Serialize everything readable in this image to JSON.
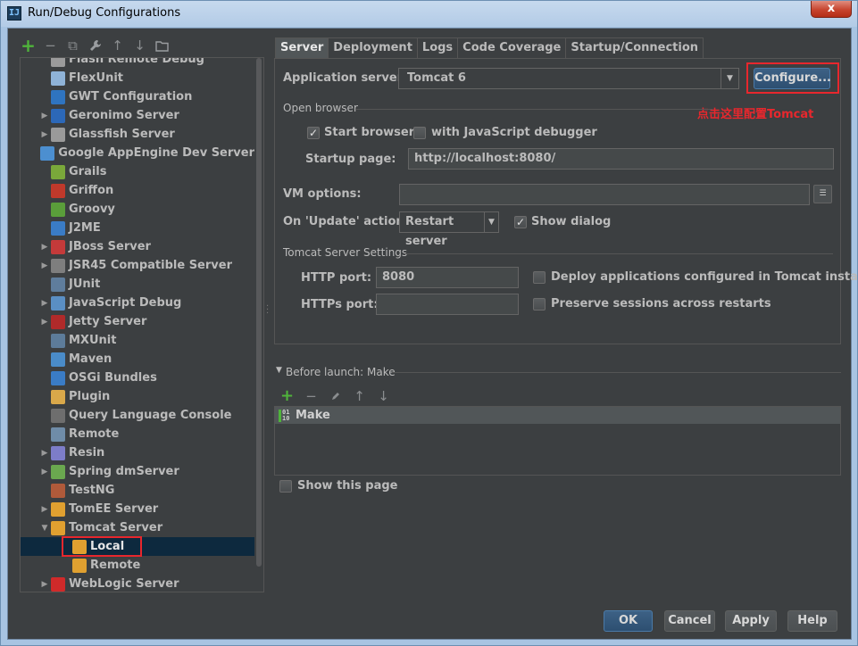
{
  "window": {
    "title": "Run/Debug Configurations",
    "app_icon": "IJ",
    "close": "x"
  },
  "left_toolbar": {
    "add": "+",
    "remove": "−",
    "copy": "⧉",
    "edit_defaults": "🔧",
    "move_up": "↑",
    "move_down": "↓",
    "folder": "▭"
  },
  "tree": [
    {
      "label": "Flash Remote Debug",
      "icon": "flash-remote-icon",
      "color": "#9b9b9b",
      "expandable": false
    },
    {
      "label": "FlexUnit",
      "icon": "flexunit-icon",
      "color": "#8fb3d8",
      "expandable": false
    },
    {
      "label": "GWT Configuration",
      "icon": "gwt-icon",
      "color": "#2f74c0",
      "expandable": false
    },
    {
      "label": "Geronimo Server",
      "icon": "geronimo-icon",
      "color": "#2c68b8",
      "expandable": true
    },
    {
      "label": "Glassfish Server",
      "icon": "glassfish-icon",
      "color": "#9a9a9a",
      "expandable": true
    },
    {
      "label": "Google AppEngine Dev Server",
      "icon": "appengine-icon",
      "color": "#4c8fd0",
      "expandable": false
    },
    {
      "label": "Grails",
      "icon": "grails-icon",
      "color": "#7aa83a",
      "expandable": false
    },
    {
      "label": "Griffon",
      "icon": "griffon-icon",
      "color": "#c0392b",
      "expandable": false
    },
    {
      "label": "Groovy",
      "icon": "groovy-icon",
      "color": "#5a9e3a",
      "expandable": false
    },
    {
      "label": "J2ME",
      "icon": "j2me-icon",
      "color": "#3a7cc6",
      "expandable": false
    },
    {
      "label": "JBoss Server",
      "icon": "jboss-icon",
      "color": "#c43a3a",
      "expandable": true
    },
    {
      "label": "JSR45 Compatible Server",
      "icon": "jsr45-icon",
      "color": "#7e7e7e",
      "expandable": true
    },
    {
      "label": "JUnit",
      "icon": "junit-icon",
      "color": "#5f7d9c",
      "expandable": false
    },
    {
      "label": "JavaScript Debug",
      "icon": "js-debug-icon",
      "color": "#5a8fc4",
      "expandable": true
    },
    {
      "label": "Jetty Server",
      "icon": "jetty-icon",
      "color": "#b02a2a",
      "expandable": true
    },
    {
      "label": "MXUnit",
      "icon": "mxunit-icon",
      "color": "#5d7c9a",
      "expandable": false
    },
    {
      "label": "Maven",
      "icon": "maven-icon",
      "color": "#4a8cc9",
      "expandable": false
    },
    {
      "label": "OSGi Bundles",
      "icon": "osgi-icon",
      "color": "#3a7cc6",
      "expandable": false
    },
    {
      "label": "Plugin",
      "icon": "plugin-icon",
      "color": "#d9a84a",
      "expandable": false
    },
    {
      "label": "Query Language Console",
      "icon": "ql-console-icon",
      "color": "#6e6e6e",
      "expandable": false
    },
    {
      "label": "Remote",
      "icon": "remote-icon",
      "color": "#6f8ca8",
      "expandable": false
    },
    {
      "label": "Resin",
      "icon": "resin-icon",
      "color": "#7d7dc8",
      "expandable": true
    },
    {
      "label": "Spring dmServer",
      "icon": "spring-dm-icon",
      "color": "#6aa84f",
      "expandable": true
    },
    {
      "label": "TestNG",
      "icon": "testng-icon",
      "color": "#b05a3a",
      "expandable": false
    },
    {
      "label": "TomEE Server",
      "icon": "tomee-icon",
      "color": "#e0a030",
      "expandable": true
    },
    {
      "label": "Tomcat Server",
      "icon": "tomcat-icon",
      "color": "#e0a030",
      "expandable": true,
      "expanded": true
    },
    {
      "label": "Local",
      "icon": "tomcat-local-icon",
      "color": "#e0a030",
      "expandable": false,
      "child": true,
      "selected": true
    },
    {
      "label": "Remote",
      "icon": "tomcat-remote-icon",
      "color": "#e0a030",
      "expandable": false,
      "child": true
    },
    {
      "label": "WebLogic Server",
      "icon": "weblogic-icon",
      "color": "#d02a2a",
      "expandable": true
    }
  ],
  "tabs": [
    "Server",
    "Deployment",
    "Logs",
    "Code Coverage",
    "Startup/Connection"
  ],
  "server": {
    "app_server_label": "Application server:",
    "app_server_value": "Tomcat 6",
    "configure_button": "Configure...",
    "annotation": "点击这里配置Tomcat",
    "open_browser_title": "Open browser",
    "start_browser_label": "Start browser",
    "start_browser_checked": true,
    "js_debugger_label": "with JavaScript debugger",
    "js_debugger_checked": false,
    "startup_page_label": "Startup page:",
    "startup_page_value": "http://localhost:8080/",
    "vm_options_label": "VM options:",
    "vm_options_value": "",
    "on_update_label": "On 'Update' action:",
    "on_update_value": "Restart server",
    "show_dialog_label": "Show dialog",
    "show_dialog_checked": true,
    "tomcat_settings_title": "Tomcat Server Settings",
    "http_port_label": "HTTP port:",
    "http_port_value": "8080",
    "https_port_label": "HTTPs port:",
    "https_port_value": "",
    "deploy_label": "Deploy applications configured in Tomcat instance",
    "deploy_checked": false,
    "preserve_label": "Preserve sessions across restarts",
    "preserve_checked": false
  },
  "before_launch": {
    "title": "Before launch: Make",
    "items": [
      "Make"
    ]
  },
  "show_this_page_label": "Show this page",
  "show_this_page_checked": false,
  "footer": {
    "ok": "OK",
    "cancel": "Cancel",
    "apply": "Apply",
    "help": "Help"
  },
  "colors": {
    "annotation_red": "#e8272d",
    "add_green": "#4fb43b",
    "panel_bg": "#3c3f41",
    "selection": "#0d293e"
  }
}
